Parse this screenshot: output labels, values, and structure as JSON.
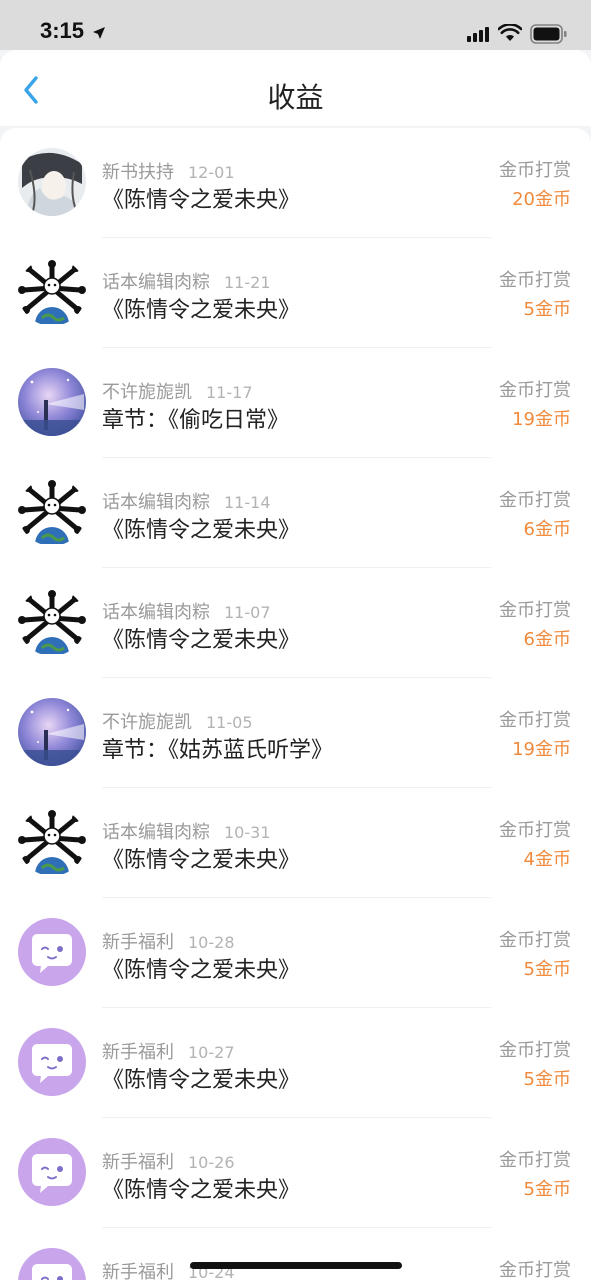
{
  "status_bar": {
    "time": "3:15"
  },
  "nav": {
    "title": "收益"
  },
  "records": [
    {
      "avatar": "avatar-sketch-portrait",
      "sender": "新书扶持",
      "date": "12-01",
      "title": "《陈情令之爱未央》",
      "reward_type": "金币打赏",
      "amount": "20金币"
    },
    {
      "avatar": "avatar-bones-planet",
      "sender": "话本编辑肉粽",
      "date": "11-21",
      "title": "《陈情令之爱未央》",
      "reward_type": "金币打赏",
      "amount": "5金币"
    },
    {
      "avatar": "avatar-galaxy-lighthouse",
      "sender": "不许旎旎凯",
      "date": "11-17",
      "title": "章节：《偷吃日常》",
      "reward_type": "金币打赏",
      "amount": "19金币"
    },
    {
      "avatar": "avatar-bones-planet",
      "sender": "话本编辑肉粽",
      "date": "11-14",
      "title": "《陈情令之爱未央》",
      "reward_type": "金币打赏",
      "amount": "6金币"
    },
    {
      "avatar": "avatar-bones-planet",
      "sender": "话本编辑肉粽",
      "date": "11-07",
      "title": "《陈情令之爱未央》",
      "reward_type": "金币打赏",
      "amount": "6金币"
    },
    {
      "avatar": "avatar-galaxy-lighthouse",
      "sender": "不许旎旎凯",
      "date": "11-05",
      "title": "章节：《姑苏蓝氏听学》",
      "reward_type": "金币打赏",
      "amount": "19金币"
    },
    {
      "avatar": "avatar-bones-planet",
      "sender": "话本编辑肉粽",
      "date": "10-31",
      "title": "《陈情令之爱未央》",
      "reward_type": "金币打赏",
      "amount": "4金币"
    },
    {
      "avatar": "avatar-purple-chat",
      "sender": "新手福利",
      "date": "10-28",
      "title": "《陈情令之爱未央》",
      "reward_type": "金币打赏",
      "amount": "5金币"
    },
    {
      "avatar": "avatar-purple-chat",
      "sender": "新手福利",
      "date": "10-27",
      "title": "《陈情令之爱未央》",
      "reward_type": "金币打赏",
      "amount": "5金币"
    },
    {
      "avatar": "avatar-purple-chat",
      "sender": "新手福利",
      "date": "10-26",
      "title": "《陈情令之爱未央》",
      "reward_type": "金币打赏",
      "amount": "5金币"
    },
    {
      "avatar": "avatar-purple-chat",
      "sender": "新手福利",
      "date": "10-24",
      "title": "",
      "reward_type": "金币打赏",
      "amount": ""
    }
  ],
  "colors": {
    "accent_blue": "#3aa4e8",
    "amount_orange": "#f08a3c",
    "muted_gray": "#9a9a9a",
    "avatar_purple": "#c9a6ec"
  }
}
